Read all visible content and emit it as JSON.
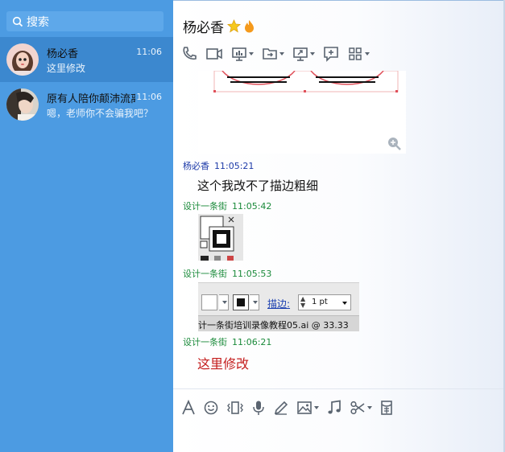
{
  "sidebar": {
    "search_placeholder": "搜索",
    "contacts": [
      {
        "name": "杨必香",
        "last_message": "这里修改",
        "time": "11:06",
        "selected": true
      },
      {
        "name": "原有人陪你颠沛流离",
        "last_message": "嗯，老师你不会骗我吧？",
        "time": "11:06",
        "selected": false
      }
    ]
  },
  "chat": {
    "title": "杨必香",
    "messages": [
      {
        "sender": "杨必香",
        "time": "11:05:21",
        "text": "这个我改不了描边粗细"
      },
      {
        "sender": "设计一条街",
        "time": "11:05:42",
        "text": ""
      },
      {
        "sender": "设计一条街",
        "time": "11:05:53",
        "text": ""
      },
      {
        "sender": "设计一条街",
        "time": "11:06:21",
        "text": "这里修改"
      }
    ],
    "screenshot_stroke_label": "描边:",
    "screenshot_stroke_value": "1 pt",
    "screenshot_file_title": "计一条街培训录像教程05.ai @ 33.33"
  },
  "colors": {
    "sidebar_bg": "#4c9be2",
    "selected_bg": "#3c88cf",
    "peer_name": "#1d3aa8",
    "me_name": "#1a8a3a",
    "red_text": "#c41d1d"
  }
}
